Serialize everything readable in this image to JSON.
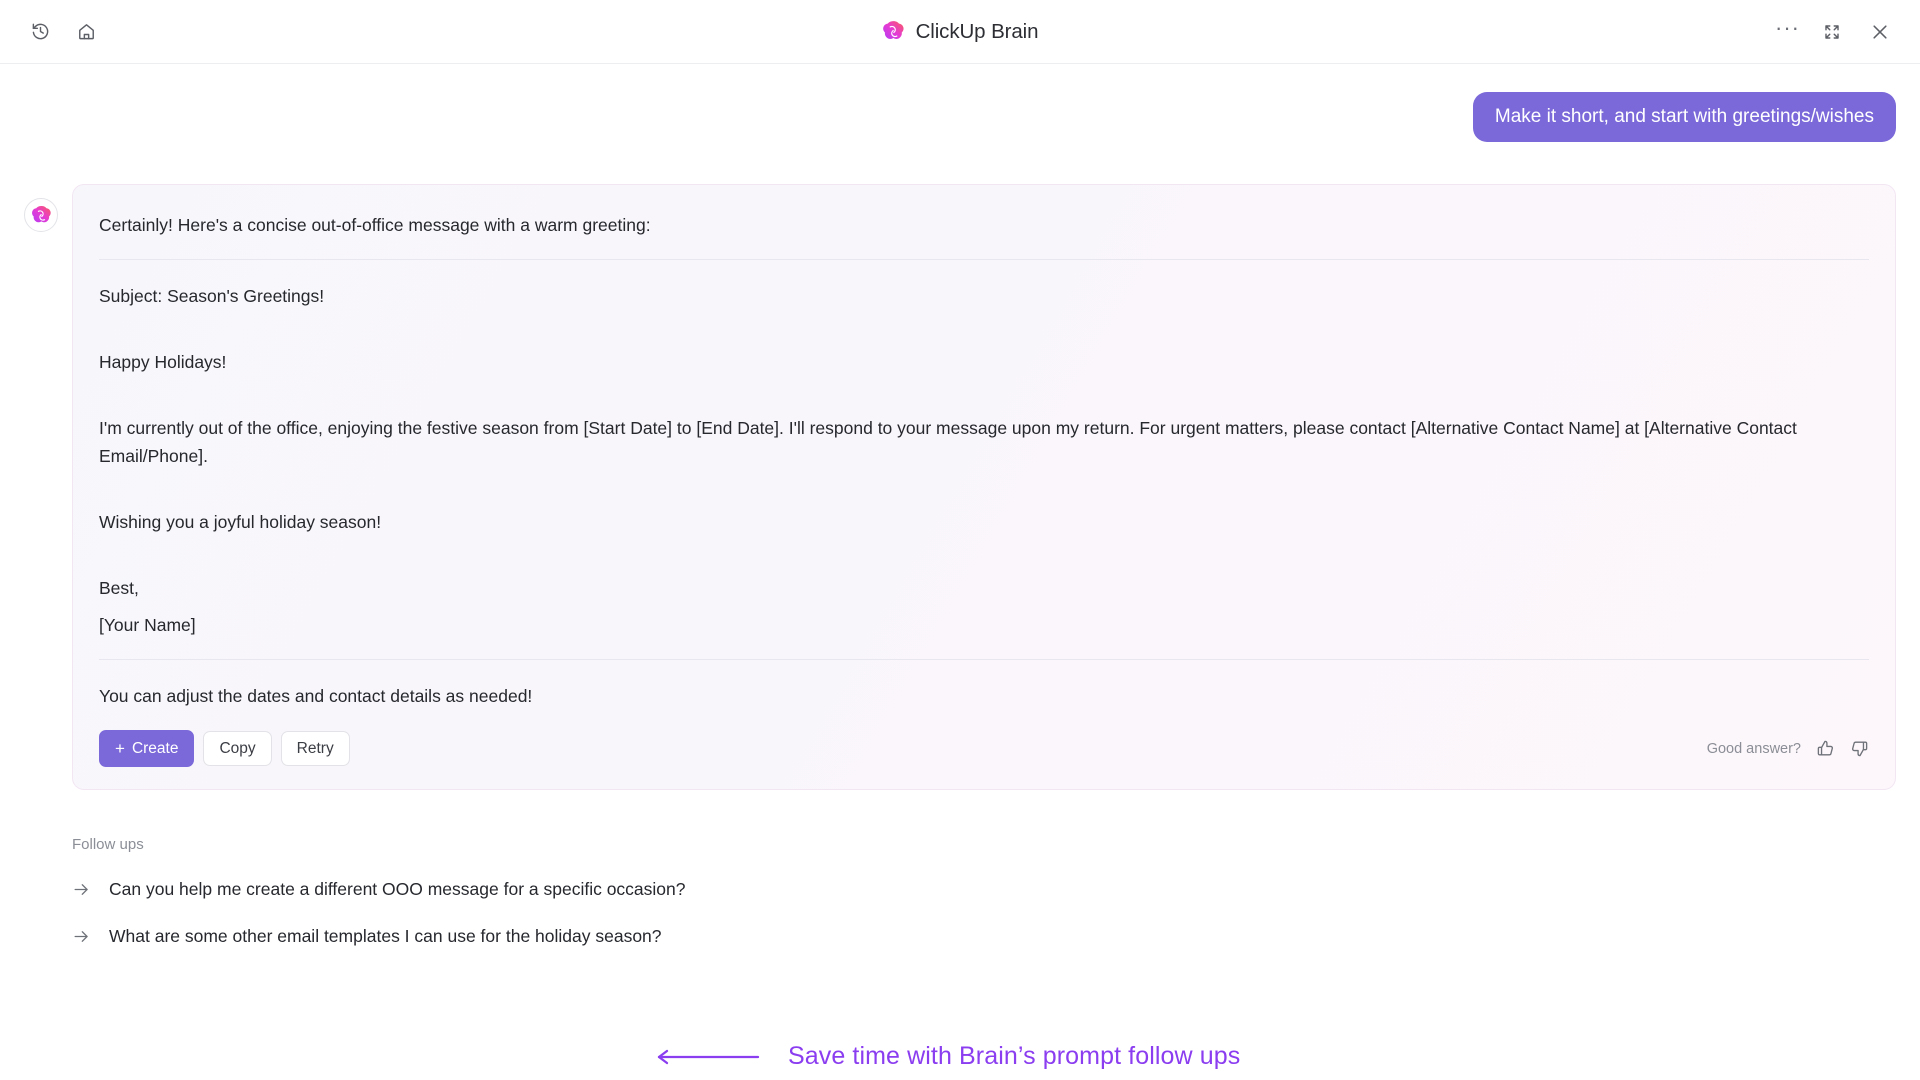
{
  "titlebar": {
    "app_title": "ClickUp Brain",
    "icons": {
      "history": "history-clock-icon",
      "home": "home-icon",
      "more": "···",
      "collapse": "collapse-arrows-icon",
      "close": "close-x-icon"
    }
  },
  "conversation": {
    "user_message": "Make it short, and start with greetings/wishes",
    "assistant": {
      "lead": "Certainly! Here's a concise out-of-office message with a warm greeting:",
      "subject": "Subject: Season's Greetings!",
      "greeting": "Happy Holidays!",
      "body": "I'm currently out of the office, enjoying the festive season from [Start Date] to [End Date]. I'll respond to your message upon my return. For urgent matters, please contact [Alternative Contact Name] at [Alternative Contact Email/Phone].",
      "wish": "Wishing you a joyful holiday season!",
      "signoff": "Best,",
      "name_placeholder": "[Your Name]",
      "note": "You can adjust the dates and contact details as needed!"
    },
    "actions": {
      "create_label": "Create",
      "create_plus": "+",
      "copy_label": "Copy",
      "retry_label": "Retry"
    },
    "feedback": {
      "prompt": "Good answer?",
      "thumb_up": "thumbs-up-icon",
      "thumb_down": "thumbs-down-icon"
    }
  },
  "followups": {
    "title": "Follow ups",
    "items": [
      {
        "text": "Can you help me create a different OOO message for a specific occasion?"
      },
      {
        "text": "What are some other email templates I can use for the holiday season?"
      }
    ]
  },
  "annotation": {
    "text": "Save time with Brain’s prompt follow ups",
    "color": "#8B3DF0"
  },
  "colors": {
    "accent_purple": "#7B68D9",
    "annotation_purple": "#8B3DF0",
    "logo_gradient_start": "#C23BF5",
    "logo_gradient_end": "#FB5C6B"
  }
}
